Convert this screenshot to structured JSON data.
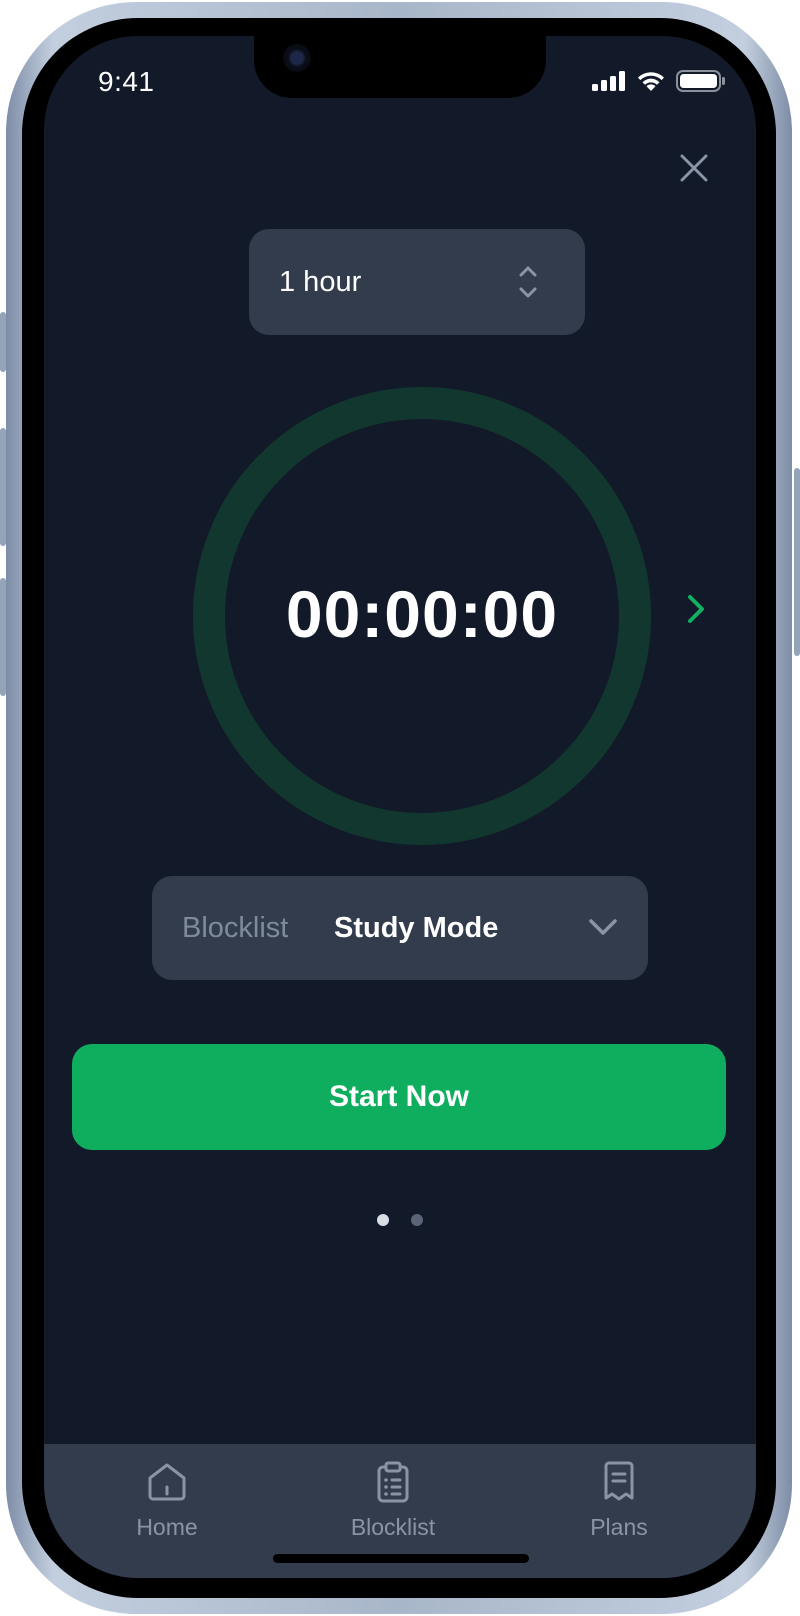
{
  "status_bar": {
    "time": "9:41"
  },
  "duration": {
    "value": "1 hour"
  },
  "timer": {
    "display": "00:00:00"
  },
  "blocklist": {
    "label": "Blocklist",
    "value": "Study Mode"
  },
  "start_button": {
    "label": "Start Now"
  },
  "pagination": {
    "total": 2,
    "active_index": 0
  },
  "tab_bar": {
    "items": [
      {
        "label": "Home",
        "icon": "home-icon"
      },
      {
        "label": "Blocklist",
        "icon": "clipboard-list-icon"
      },
      {
        "label": "Plans",
        "icon": "receipt-icon"
      }
    ]
  },
  "colors": {
    "background": "#121928",
    "card": "#323c4d",
    "accent": "#0fae5e",
    "ring": "#12372f",
    "muted_text": "#7f8a9c"
  }
}
